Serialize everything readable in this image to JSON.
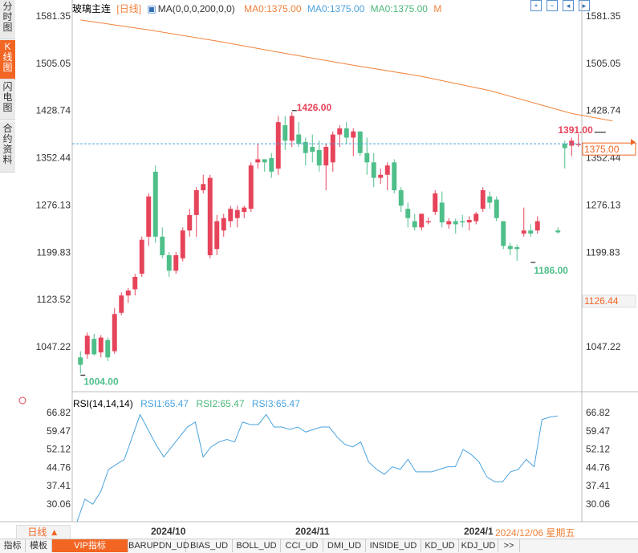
{
  "sidebar": {
    "tabs": [
      {
        "label": "分时图"
      },
      {
        "label": "K线图"
      },
      {
        "label": "闪电图"
      },
      {
        "label": "合约资料"
      }
    ]
  },
  "toolbar": {
    "title": "玻璃主连",
    "period": "[日线]",
    "ma_params": "MA(0,0,0,200,0,0)",
    "ma1": "MA0:1375.00",
    "ma2": "MA0:1375.00",
    "ma3": "MA0:1375.00",
    "m": "M"
  },
  "rsi_header": {
    "label": "RSI(14,14,14)",
    "rsi1": "RSI1:65.47",
    "rsi2": "RSI2:65.47",
    "rsi3": "RSI3:65.47"
  },
  "period_button": "日线 ▲",
  "x_axis": {
    "labels": [
      "2024/10",
      "2024/11",
      "2024/1"
    ],
    "cursor_date": "2024/12/06 星期五"
  },
  "bottom_tabs": [
    "指标",
    "模板",
    "VIP指标",
    "BARUPDN_UD",
    "BIAS_UD",
    "BOLL_UD",
    "CCI_UD",
    "DMI_UD",
    "INSIDE_UD",
    "KD_UD",
    "KDJ_UD",
    ">>"
  ],
  "colors": {
    "up": "#e6445a",
    "down": "#4fbf8a",
    "ma": "#f0823a",
    "rsi": "#4aa3df",
    "current_line": "#4aa3df",
    "accent": "#f26522"
  },
  "chart_data": [
    {
      "type": "candlestick",
      "y_axis_ticks": [
        "1581.35",
        "1505.05",
        "1428.74",
        "1352.44",
        "1276.13",
        "1199.83",
        "1123.52",
        "1047.22"
      ],
      "ylim": [
        1000,
        1600
      ],
      "current_price": "1375.00",
      "cursor_price": "1126.44",
      "annotations": [
        {
          "label": "1426.00",
          "value": 1426.0,
          "index": 31
        },
        {
          "label": "1391.00",
          "value": 1391.0,
          "index": 75
        },
        {
          "label": "1186.00",
          "value": 1186.0,
          "index": 66
        },
        {
          "label": "1004.00",
          "value": 1004.0,
          "index": 0
        }
      ],
      "ma_line": [
        {
          "index": 0,
          "value": 1575
        },
        {
          "index": 10,
          "value": 1559
        },
        {
          "index": 20,
          "value": 1541
        },
        {
          "index": 30,
          "value": 1521
        },
        {
          "index": 40,
          "value": 1502
        },
        {
          "index": 50,
          "value": 1484
        },
        {
          "index": 60,
          "value": 1461
        },
        {
          "index": 70,
          "value": 1424
        },
        {
          "index": 76,
          "value": 1412
        }
      ],
      "candles": [
        {
          "o": 1030,
          "h": 1040,
          "l": 1004,
          "c": 1018
        },
        {
          "o": 1035,
          "h": 1070,
          "l": 1028,
          "c": 1065
        },
        {
          "o": 1060,
          "h": 1068,
          "l": 1033,
          "c": 1035
        },
        {
          "o": 1038,
          "h": 1066,
          "l": 1030,
          "c": 1062
        },
        {
          "o": 1058,
          "h": 1062,
          "l": 1024,
          "c": 1030
        },
        {
          "o": 1040,
          "h": 1110,
          "l": 1036,
          "c": 1100
        },
        {
          "o": 1102,
          "h": 1135,
          "l": 1098,
          "c": 1130
        },
        {
          "o": 1130,
          "h": 1142,
          "l": 1118,
          "c": 1138
        },
        {
          "o": 1140,
          "h": 1165,
          "l": 1130,
          "c": 1160
        },
        {
          "o": 1165,
          "h": 1225,
          "l": 1160,
          "c": 1220
        },
        {
          "o": 1225,
          "h": 1295,
          "l": 1210,
          "c": 1290
        },
        {
          "o": 1330,
          "h": 1340,
          "l": 1215,
          "c": 1225
        },
        {
          "o": 1225,
          "h": 1240,
          "l": 1190,
          "c": 1195
        },
        {
          "o": 1195,
          "h": 1200,
          "l": 1160,
          "c": 1170
        },
        {
          "o": 1170,
          "h": 1200,
          "l": 1165,
          "c": 1195
        },
        {
          "o": 1190,
          "h": 1240,
          "l": 1185,
          "c": 1235
        },
        {
          "o": 1235,
          "h": 1270,
          "l": 1225,
          "c": 1260
        },
        {
          "o": 1260,
          "h": 1305,
          "l": 1225,
          "c": 1300
        },
        {
          "o": 1300,
          "h": 1325,
          "l": 1295,
          "c": 1310
        },
        {
          "o": 1195,
          "h": 1325,
          "l": 1190,
          "c": 1320
        },
        {
          "o": 1205,
          "h": 1260,
          "l": 1195,
          "c": 1250
        },
        {
          "o": 1235,
          "h": 1262,
          "l": 1225,
          "c": 1255
        },
        {
          "o": 1250,
          "h": 1275,
          "l": 1240,
          "c": 1270
        },
        {
          "o": 1255,
          "h": 1275,
          "l": 1240,
          "c": 1268
        },
        {
          "o": 1265,
          "h": 1275,
          "l": 1255,
          "c": 1272
        },
        {
          "o": 1270,
          "h": 1345,
          "l": 1265,
          "c": 1340
        },
        {
          "o": 1345,
          "h": 1375,
          "l": 1335,
          "c": 1350
        },
        {
          "o": 1350,
          "h": 1350,
          "l": 1330,
          "c": 1345
        },
        {
          "o": 1352,
          "h": 1360,
          "l": 1320,
          "c": 1330
        },
        {
          "o": 1335,
          "h": 1420,
          "l": 1325,
          "c": 1410
        },
        {
          "o": 1405,
          "h": 1420,
          "l": 1365,
          "c": 1380
        },
        {
          "o": 1380,
          "h": 1426,
          "l": 1370,
          "c": 1420
        },
        {
          "o": 1390,
          "h": 1410,
          "l": 1370,
          "c": 1375
        },
        {
          "o": 1378,
          "h": 1385,
          "l": 1340,
          "c": 1360
        },
        {
          "o": 1370,
          "h": 1390,
          "l": 1345,
          "c": 1362
        },
        {
          "o": 1365,
          "h": 1380,
          "l": 1330,
          "c": 1340
        },
        {
          "o": 1340,
          "h": 1375,
          "l": 1300,
          "c": 1370
        },
        {
          "o": 1345,
          "h": 1395,
          "l": 1330,
          "c": 1390
        },
        {
          "o": 1390,
          "h": 1405,
          "l": 1370,
          "c": 1400
        },
        {
          "o": 1400,
          "h": 1410,
          "l": 1375,
          "c": 1385
        },
        {
          "o": 1385,
          "h": 1400,
          "l": 1355,
          "c": 1395
        },
        {
          "o": 1395,
          "h": 1395,
          "l": 1355,
          "c": 1360
        },
        {
          "o": 1360,
          "h": 1385,
          "l": 1325,
          "c": 1345
        },
        {
          "o": 1345,
          "h": 1360,
          "l": 1305,
          "c": 1320
        },
        {
          "o": 1320,
          "h": 1335,
          "l": 1310,
          "c": 1325
        },
        {
          "o": 1325,
          "h": 1345,
          "l": 1300,
          "c": 1340
        },
        {
          "o": 1345,
          "h": 1350,
          "l": 1295,
          "c": 1300
        },
        {
          "o": 1300,
          "h": 1305,
          "l": 1265,
          "c": 1275
        },
        {
          "o": 1270,
          "h": 1280,
          "l": 1240,
          "c": 1255
        },
        {
          "o": 1250,
          "h": 1262,
          "l": 1235,
          "c": 1240
        },
        {
          "o": 1240,
          "h": 1262,
          "l": 1235,
          "c": 1262
        },
        {
          "o": 1250,
          "h": 1256,
          "l": 1245,
          "c": 1250
        },
        {
          "o": 1265,
          "h": 1300,
          "l": 1260,
          "c": 1295
        },
        {
          "o": 1280,
          "h": 1298,
          "l": 1240,
          "c": 1248
        },
        {
          "o": 1245,
          "h": 1255,
          "l": 1238,
          "c": 1250
        },
        {
          "o": 1250,
          "h": 1254,
          "l": 1230,
          "c": 1245
        },
        {
          "o": 1250,
          "h": 1260,
          "l": 1240,
          "c": 1248
        },
        {
          "o": 1248,
          "h": 1258,
          "l": 1235,
          "c": 1252
        },
        {
          "o": 1250,
          "h": 1265,
          "l": 1245,
          "c": 1262
        },
        {
          "o": 1270,
          "h": 1305,
          "l": 1265,
          "c": 1300
        },
        {
          "o": 1290,
          "h": 1298,
          "l": 1270,
          "c": 1280
        },
        {
          "o": 1285,
          "h": 1290,
          "l": 1250,
          "c": 1255
        },
        {
          "o": 1250,
          "h": 1250,
          "l": 1205,
          "c": 1210
        },
        {
          "o": 1210,
          "h": 1215,
          "l": 1195,
          "c": 1205
        },
        {
          "o": 1208,
          "h": 1212,
          "l": 1186,
          "c": 1205
        },
        {
          "o": 1230,
          "h": 1272,
          "l": 1225,
          "c": 1235
        },
        {
          "o": 1235,
          "h": 1245,
          "l": 1225,
          "c": 1230
        },
        {
          "o": 1235,
          "h": 1258,
          "l": 1230,
          "c": 1250
        },
        {
          "o": 1235,
          "h": 1240,
          "l": 1230,
          "c": 1232
        },
        {
          "o": 1375,
          "h": 1380,
          "l": 1335,
          "c": 1368
        },
        {
          "o": 1372,
          "h": 1385,
          "l": 1355,
          "c": 1380
        },
        {
          "o": 1375,
          "h": 1391,
          "l": 1370,
          "c": 1375
        }
      ]
    },
    {
      "type": "line",
      "name": "RSI1",
      "y_axis_ticks": [
        "66.82",
        "59.47",
        "52.12",
        "44.76",
        "37.41",
        "30.06"
      ],
      "ylim": [
        26,
        68
      ],
      "values": [
        22,
        32,
        30,
        35,
        44,
        46,
        48,
        57,
        66,
        60,
        54,
        49,
        53,
        57,
        61,
        63,
        49,
        53,
        55,
        56,
        55,
        63,
        62,
        62,
        66,
        61,
        61,
        60,
        61,
        59,
        60,
        61,
        61,
        57,
        54,
        53,
        55,
        47,
        44,
        42,
        45,
        44,
        48,
        43,
        43,
        43,
        44,
        45,
        45,
        52,
        50,
        47,
        41,
        39,
        39,
        43,
        44,
        48,
        45,
        64,
        65,
        65.47
      ]
    }
  ]
}
